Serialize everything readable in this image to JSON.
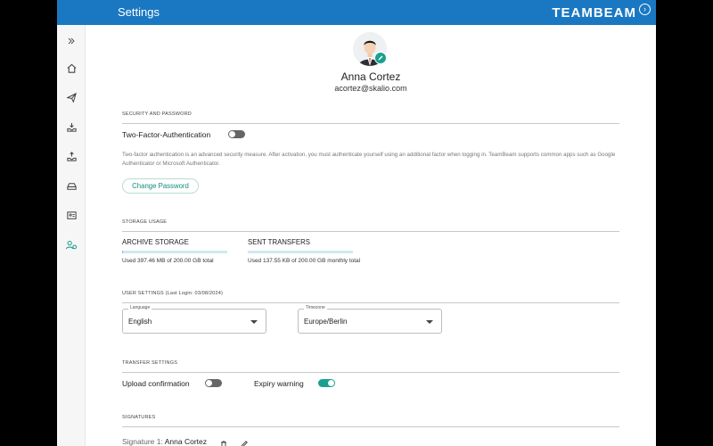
{
  "header": {
    "title": "Settings",
    "brand": "TEAMBEAM",
    "brand_icon": "chevron-right-circle-icon"
  },
  "sidebar": {
    "items": [
      {
        "icon": "expand-icon"
      },
      {
        "icon": "home-icon"
      },
      {
        "icon": "send-icon"
      },
      {
        "icon": "inbox-download-icon"
      },
      {
        "icon": "inbox-upload-icon"
      },
      {
        "icon": "drive-icon"
      },
      {
        "icon": "contacts-card-icon"
      },
      {
        "icon": "user-settings-icon"
      }
    ]
  },
  "profile": {
    "name": "Anna Cortez",
    "email": "acortez@skalio.com"
  },
  "security": {
    "section_label": "SECURITY AND PASSWORD",
    "tfa_label": "Two-Factor-Authentication",
    "tfa_enabled": false,
    "description": "Two-factor authentication is an advanced security measure. After activation, you must authenticate yourself using an additional factor when logging in. TeamBeam supports common apps such as Google Authenticator or Microsoft Authenticator.",
    "change_password_label": "Change Password"
  },
  "storage": {
    "section_label": "STORAGE USAGE",
    "archive": {
      "title": "ARCHIVE STORAGE",
      "text": "Used 397.46 MB of 200.00 GB total",
      "fraction": 0.002
    },
    "sent": {
      "title": "SENT TRANSFERS",
      "text": "Used 137.55 KB of 200.00 GB monthly total",
      "fraction": 0.0
    }
  },
  "user_settings": {
    "section_label": "USER SETTINGS (Last Login: 03/08/2024)",
    "language": {
      "legend": "Language",
      "value": "English"
    },
    "timezone": {
      "legend": "Timezone",
      "value": "Europe/Berlin"
    }
  },
  "transfer_settings": {
    "section_label": "TRANSFER SETTINGS",
    "upload_confirmation_label": "Upload confirmation",
    "upload_confirmation_enabled": false,
    "expiry_warning_label": "Expiry warning",
    "expiry_warning_enabled": true
  },
  "signatures": {
    "section_label": "SIGNATURES",
    "items": [
      {
        "label": "Signature 1:",
        "name": "Anna Cortez"
      }
    ]
  },
  "colors": {
    "header_blue": "#1a78c2",
    "accent_teal": "#1aa08e"
  }
}
